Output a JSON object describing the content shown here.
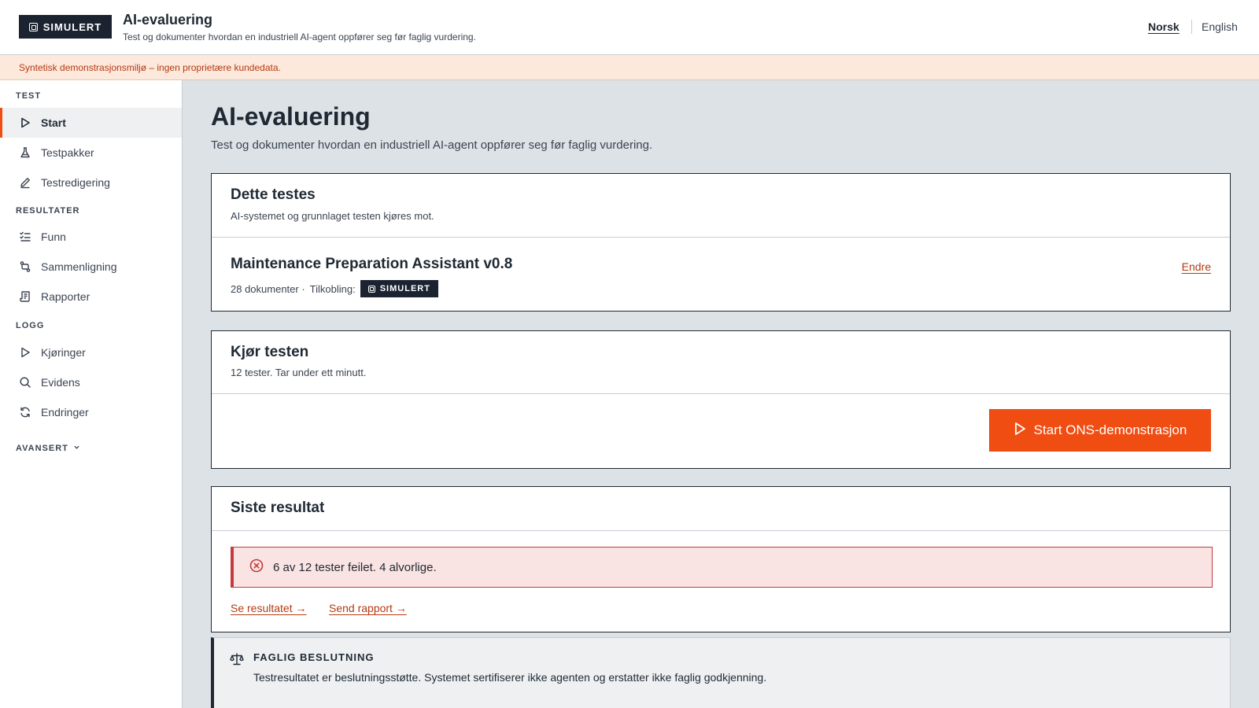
{
  "header": {
    "badge": "SIMULERT",
    "title": "AI-evaluering",
    "subtitle": "Test og dokumenter hvordan en industriell AI-agent oppfører seg før faglig vurdering.",
    "lang_nb": "Norsk",
    "lang_en": "English"
  },
  "banner": "Syntetisk demonstrasjonsmiljø – ingen proprietære kundedata.",
  "sidebar": {
    "sections": [
      {
        "label": "TEST",
        "items": [
          {
            "label": "Start",
            "icon": "play-icon",
            "active": true
          },
          {
            "label": "Testpakker",
            "icon": "flask-icon"
          },
          {
            "label": "Testredigering",
            "icon": "pencil-icon"
          }
        ]
      },
      {
        "label": "RESULTATER",
        "items": [
          {
            "label": "Funn",
            "icon": "checklist-icon"
          },
          {
            "label": "Sammenligning",
            "icon": "compare-icon"
          },
          {
            "label": "Rapporter",
            "icon": "report-icon"
          }
        ]
      },
      {
        "label": "LOGG",
        "items": [
          {
            "label": "Kjøringer",
            "icon": "play-icon"
          },
          {
            "label": "Evidens",
            "icon": "search-icon"
          },
          {
            "label": "Endringer",
            "icon": "refresh-icon"
          }
        ]
      }
    ],
    "advanced": "AVANSERT"
  },
  "main": {
    "title": "AI-evaluering",
    "subtitle": "Test og dokumenter hvordan en industriell AI-agent oppfører seg før faglig vurdering.",
    "tested": {
      "heading": "Dette testes",
      "sub": "AI-systemet og grunnlaget testen kjøres mot.",
      "system_name": "Maintenance Preparation Assistant v0.8",
      "docs": "28 dokumenter ·",
      "connection_label": "Tilkobling:",
      "connection_badge": "SIMULERT",
      "change_link": "Endre"
    },
    "run": {
      "heading": "Kjør testen",
      "sub": "12 tester. Tar under ett minutt.",
      "button": "Start ONS-demonstrasjon"
    },
    "last_result": {
      "heading": "Siste resultat",
      "alert": "6 av 12 tester feilet. 4 alvorlige.",
      "link_view": "Se resultatet →",
      "link_send": "Send rapport →"
    },
    "decision": {
      "heading": "FAGLIG BESLUTNING",
      "text": "Testresultatet er beslutningsstøtte. Systemet sertifiserer ikke agenten og erstatter ikke faglig godkjenning."
    }
  },
  "colors": {
    "accent": "#f04d13",
    "dark": "#1b2230",
    "error": "#c53a3a",
    "banner_bg": "#fde8dc"
  }
}
